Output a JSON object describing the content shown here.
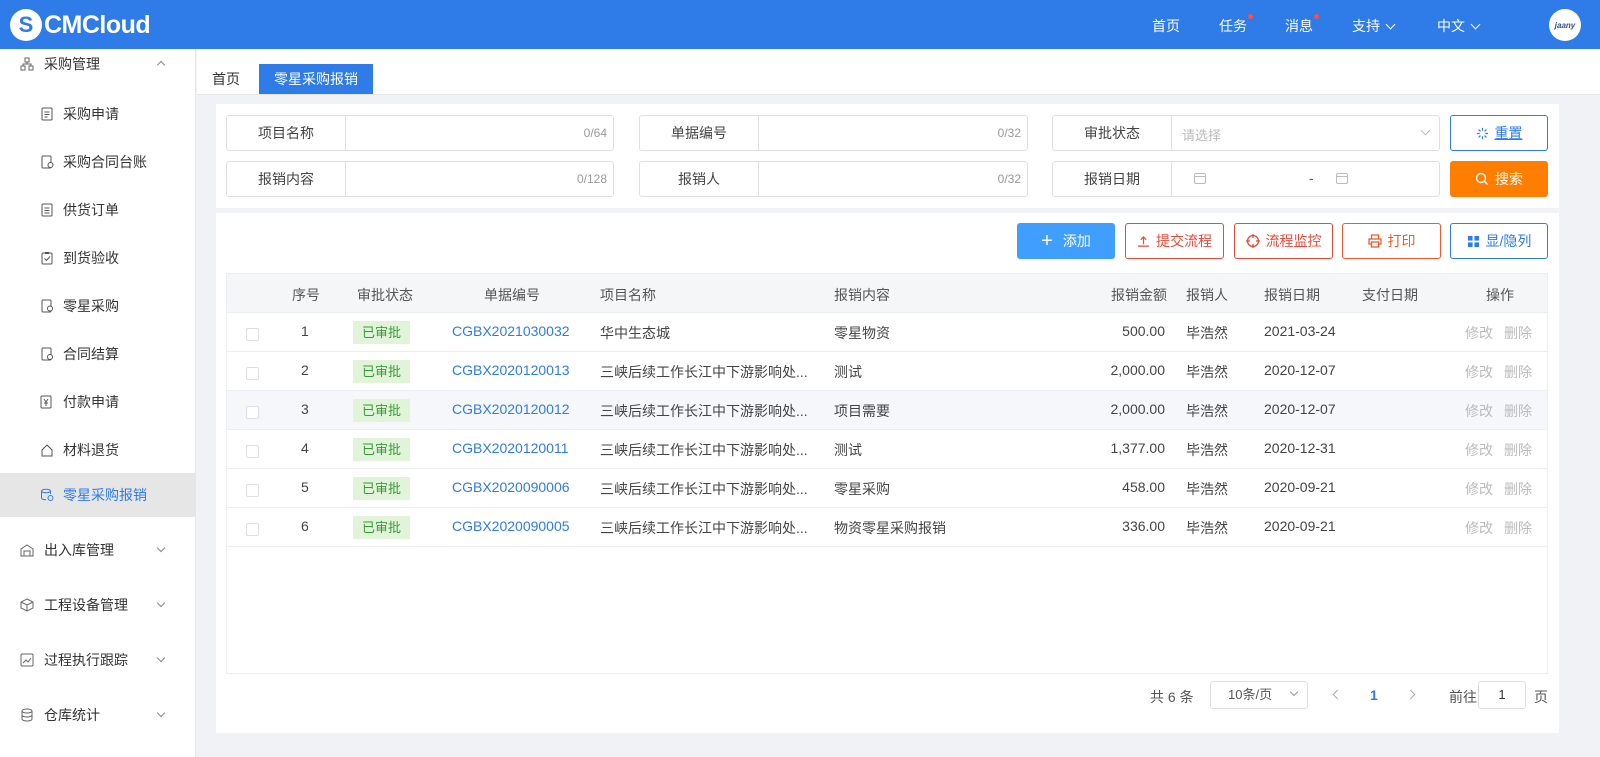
{
  "brand": {
    "mark": "S",
    "name": "CMCloud"
  },
  "topnav": {
    "home": "首页",
    "tasks": "任务",
    "messages": "消息",
    "support": "支持",
    "language": "中文",
    "avatar_text": "jaany"
  },
  "sidebar": {
    "group_purchase": "采购管理",
    "items": [
      {
        "label": "采购申请"
      },
      {
        "label": "采购合同台账"
      },
      {
        "label": "供货订单"
      },
      {
        "label": "到货验收"
      },
      {
        "label": "零星采购"
      },
      {
        "label": "合同结算"
      },
      {
        "label": "付款申请"
      },
      {
        "label": "材料退货"
      },
      {
        "label": "零星采购报销"
      }
    ],
    "groups": [
      {
        "label": "出入库管理"
      },
      {
        "label": "工程设备管理"
      },
      {
        "label": "过程执行跟踪"
      },
      {
        "label": "仓库统计"
      }
    ]
  },
  "tabs": [
    {
      "label": "首页"
    },
    {
      "label": "零星采购报销"
    }
  ],
  "filter": {
    "project_name": {
      "label": "项目名称",
      "count": "0/64"
    },
    "doc_no": {
      "label": "单据编号",
      "count": "0/32"
    },
    "status": {
      "label": "审批状态",
      "placeholder": "请选择"
    },
    "content": {
      "label": "报销内容",
      "count": "0/128"
    },
    "person": {
      "label": "报销人",
      "count": "0/32"
    },
    "date": {
      "label": "报销日期",
      "separator": "-"
    },
    "reset_label": "重置",
    "search_label": "搜索"
  },
  "toolbar": {
    "add": "添加",
    "submit": "提交流程",
    "monitor": "流程监控",
    "print": "打印",
    "columns": "显/隐列"
  },
  "table": {
    "headers": [
      "序号",
      "审批状态",
      "单据编号",
      "项目名称",
      "报销内容",
      "报销金额",
      "报销人",
      "报销日期",
      "支付日期",
      "操作"
    ],
    "rows": [
      {
        "no": "1",
        "status": "已审批",
        "doc": "CGBX2021030032",
        "project": "华中生态城",
        "content": "零星物资",
        "amount": "500.00",
        "person": "毕浩然",
        "date": "2021-03-24",
        "pay": "",
        "edit": "修改",
        "del": "删除"
      },
      {
        "no": "2",
        "status": "已审批",
        "doc": "CGBX2020120013",
        "project": "三峡后续工作长江中下游影响处...",
        "content": "测试",
        "amount": "2,000.00",
        "person": "毕浩然",
        "date": "2020-12-07",
        "pay": "",
        "edit": "修改",
        "del": "删除"
      },
      {
        "no": "3",
        "status": "已审批",
        "doc": "CGBX2020120012",
        "project": "三峡后续工作长江中下游影响处...",
        "content": "项目需要",
        "amount": "2,000.00",
        "person": "毕浩然",
        "date": "2020-12-07",
        "pay": "",
        "edit": "修改",
        "del": "删除"
      },
      {
        "no": "4",
        "status": "已审批",
        "doc": "CGBX2020120011",
        "project": "三峡后续工作长江中下游影响处...",
        "content": "测试",
        "amount": "1,377.00",
        "person": "毕浩然",
        "date": "2020-12-31",
        "pay": "",
        "edit": "修改",
        "del": "删除"
      },
      {
        "no": "5",
        "status": "已审批",
        "doc": "CGBX2020090006",
        "project": "三峡后续工作长江中下游影响处...",
        "content": "零星采购",
        "amount": "458.00",
        "person": "毕浩然",
        "date": "2020-09-21",
        "pay": "",
        "edit": "修改",
        "del": "删除"
      },
      {
        "no": "6",
        "status": "已审批",
        "doc": "CGBX2020090005",
        "project": "三峡后续工作长江中下游影响处...",
        "content": "物资零星采购报销",
        "amount": "336.00",
        "person": "毕浩然",
        "date": "2020-09-21",
        "pay": "",
        "edit": "修改",
        "del": "删除"
      }
    ]
  },
  "pagination": {
    "total": "共 6 条",
    "page_size": "10条/页",
    "current_page": "1",
    "goto_prefix": "前往",
    "goto_value": "1",
    "goto_suffix": "页"
  },
  "colors": {
    "primary": "#2f7be8",
    "search": "#ff7d00",
    "approved_bg": "#e1f3d8",
    "approved_text": "#3a9a3a",
    "danger": "#e64a3b"
  }
}
